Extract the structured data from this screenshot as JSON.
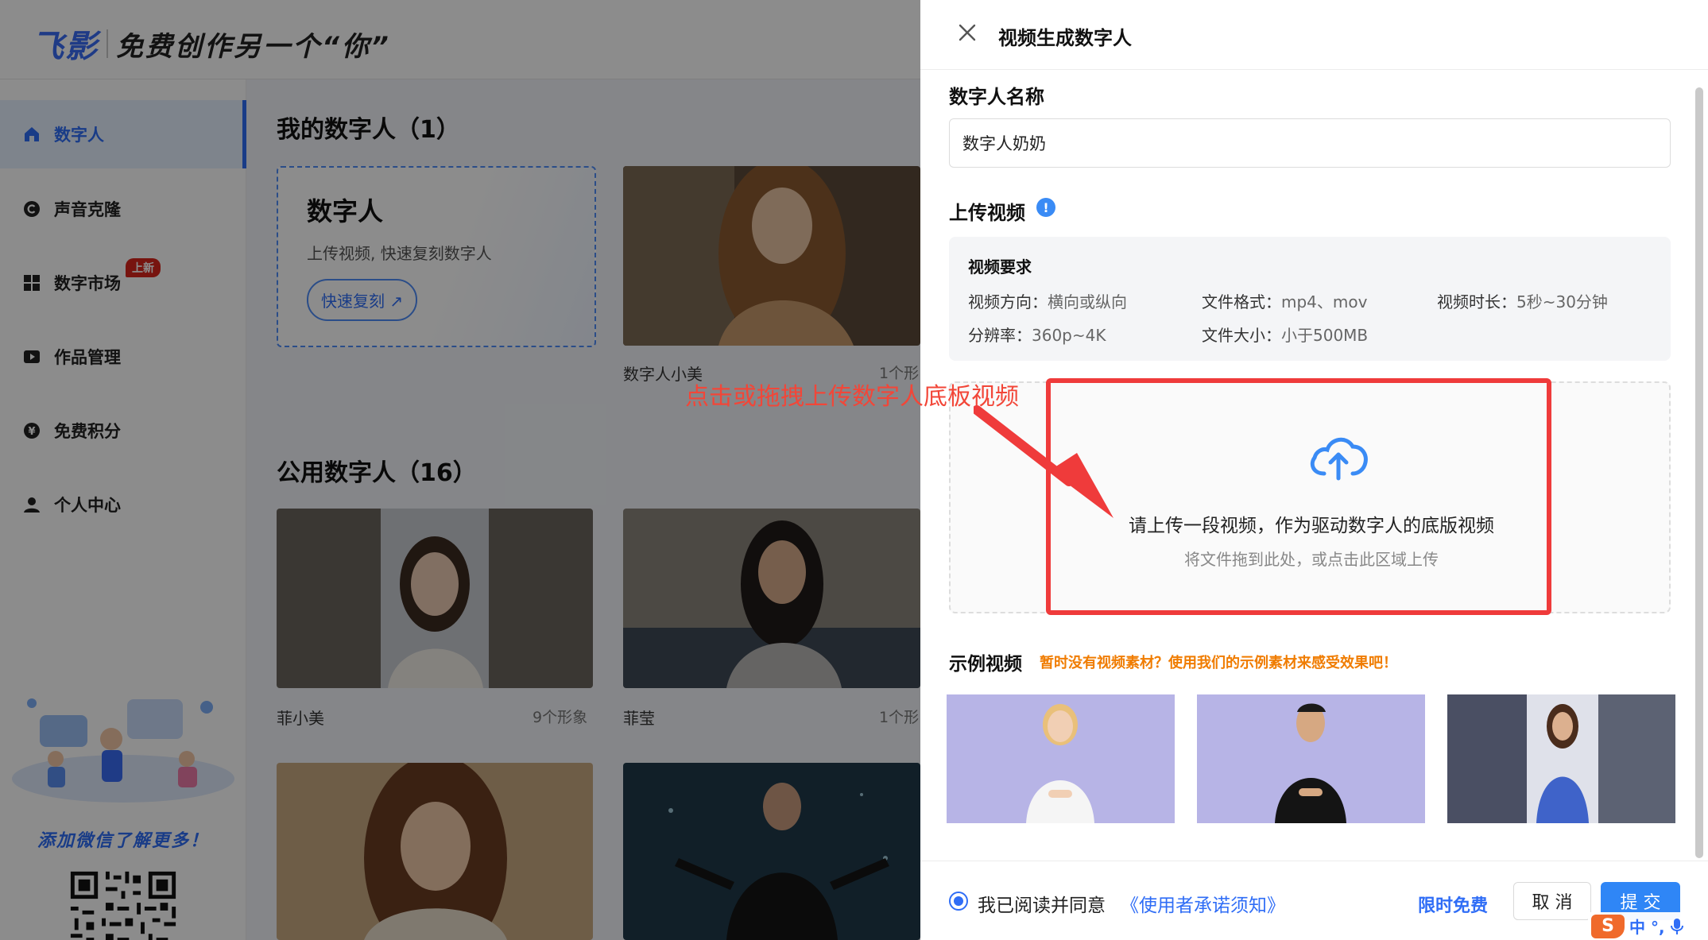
{
  "app": {
    "logo_text": "飞影",
    "slogan": "免费创作另一个“你”"
  },
  "sidebar": {
    "items": [
      {
        "label": "数字人",
        "icon": "home-icon"
      },
      {
        "label": "声音克隆",
        "icon": "copyright-icon"
      },
      {
        "label": "数字市场",
        "icon": "grid-icon",
        "badge": "上新"
      },
      {
        "label": "作品管理",
        "icon": "video-icon"
      },
      {
        "label": "免费积分",
        "icon": "coin-icon"
      },
      {
        "label": "个人中心",
        "icon": "user-icon"
      }
    ],
    "promo_text": "添加微信了解更多！"
  },
  "main": {
    "my_section_title": "我的数字人（1）",
    "create_card": {
      "title": "数字人",
      "subtitle": "上传视频, 快速复刻数字人",
      "button": "快速复刻 ↗"
    },
    "my_items": [
      {
        "name": "数字人小美",
        "count": "1个形"
      }
    ],
    "public_section_title": "公用数字人（16）",
    "public_items": [
      {
        "name": "菲小美",
        "count": "9个形象"
      },
      {
        "name": "菲莹",
        "count": "1个形"
      }
    ]
  },
  "drawer": {
    "title": "视频生成数字人",
    "name_label": "数字人名称",
    "name_value": "数字人奶奶",
    "upload_label": "上传视频",
    "info_icon": "!",
    "requirements": {
      "title": "视频要求",
      "orientation_key": "视频方向：",
      "orientation_val": "横向或纵向",
      "format_key": "文件格式：",
      "format_val": "mp4、mov",
      "duration_key": "视频时长：",
      "duration_val": "5秒~30分钟",
      "resolution_key": "分辨率：",
      "resolution_val": "360p~4K",
      "size_key": "文件大小：",
      "size_val": "小于500MB"
    },
    "upload_zone": {
      "main_text": "请上传一段视频，作为驱动数字人的底版视频",
      "sub_text": "将文件拖到此处，或点击此区域上传"
    },
    "examples": {
      "label": "示例视频",
      "tip": "暂时没有视频素材？使用我们的示例素材来感受效果吧！"
    },
    "footer": {
      "agree_text": "我已阅读并同意",
      "agree_link": "《使用者承诺须知》",
      "free_tag": "限时免费",
      "cancel": "取 消",
      "submit": "提 交"
    }
  },
  "annotation": {
    "text": "点击或拖拽上传数字人底板视频"
  },
  "ime": {
    "logo": "S",
    "text": "中 °,"
  },
  "colors": {
    "accent": "#2f6df6",
    "annotation_red": "#ef3b3b",
    "tip_orange": "#f07c00",
    "example_bg": "#b7b4e6"
  }
}
